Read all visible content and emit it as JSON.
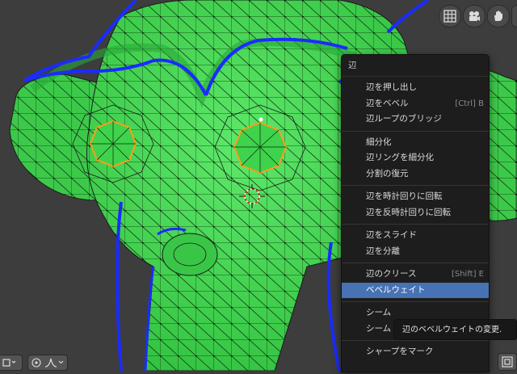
{
  "viewport": {
    "mesh_color": "#3cd24a",
    "seam_color": "#1a2cff",
    "selected_edge_color": "#ff9d1a",
    "background": "#3d3d3d"
  },
  "nav_gizmo": {
    "icons": [
      "grid-icon",
      "camera-icon",
      "hand-icon"
    ]
  },
  "context_menu": {
    "title": "辺",
    "items": [
      {
        "label": "辺を押し出し",
        "shortcut": ""
      },
      {
        "label": "辺をベベル",
        "shortcut": "[Ctrl] B"
      },
      {
        "label": "辺ループのブリッジ",
        "shortcut": ""
      },
      {
        "label": "細分化",
        "shortcut": ""
      },
      {
        "label": "辺リングを細分化",
        "shortcut": ""
      },
      {
        "label": "分割の復元",
        "shortcut": ""
      },
      {
        "label": "辺を時計回りに回転",
        "shortcut": ""
      },
      {
        "label": "辺を反時計回りに回転",
        "shortcut": ""
      },
      {
        "label": "辺をスライド",
        "shortcut": ""
      },
      {
        "label": "辺を分離",
        "shortcut": ""
      },
      {
        "label": "辺のクリース",
        "shortcut": "[Shift] E"
      },
      {
        "label": "ベベルウェイト",
        "shortcut": ""
      },
      {
        "label": "シーム",
        "shortcut": ""
      },
      {
        "label": "シーム",
        "shortcut": ""
      },
      {
        "label": "シャープをマーク",
        "shortcut": ""
      }
    ],
    "active_item": "ベベルウェイト"
  },
  "tooltip": {
    "text": "辺のベベルウェイトの変更."
  }
}
